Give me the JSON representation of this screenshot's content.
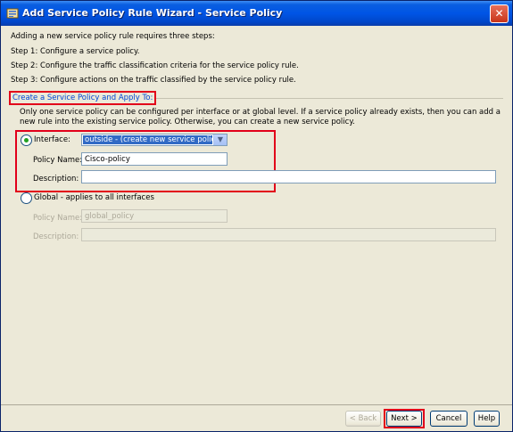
{
  "window": {
    "title": "Add Service Policy Rule Wizard - Service Policy",
    "close_glyph": "✕"
  },
  "intro": {
    "line0": "Adding a new service policy rule requires three steps:",
    "line1": "Step 1:  Configure a service policy.",
    "line2": "Step 2:  Configure the traffic classification criteria for the service policy rule.",
    "line3": "Step 3:  Configure actions on the traffic classified by the service policy rule."
  },
  "section": {
    "label": "Create a Service Policy and Apply To:",
    "desc": "Only one service policy can be configured per interface or at global level. If a service policy already exists, then you can add a new rule into the existing service policy. Otherwise, you can create a new service policy."
  },
  "interface_option": {
    "label": "Interface:",
    "selected": true,
    "select_value": "outside - (create new service policy)",
    "policy_name_label": "Policy Name:",
    "policy_name_value": "Cisco-policy",
    "description_label": "Description:",
    "description_value": ""
  },
  "global_option": {
    "label": "Global - applies to all interfaces",
    "selected": false,
    "policy_name_label": "Policy Name:",
    "policy_name_value": "global_policy",
    "description_label": "Description:",
    "description_value": ""
  },
  "buttons": {
    "back": "< Back",
    "next": "Next >",
    "cancel": "Cancel",
    "help": "Help"
  },
  "colors": {
    "highlight_red": "#e2001a",
    "section_blue": "#0046d5",
    "titlebar_blue": "#0055e5"
  }
}
